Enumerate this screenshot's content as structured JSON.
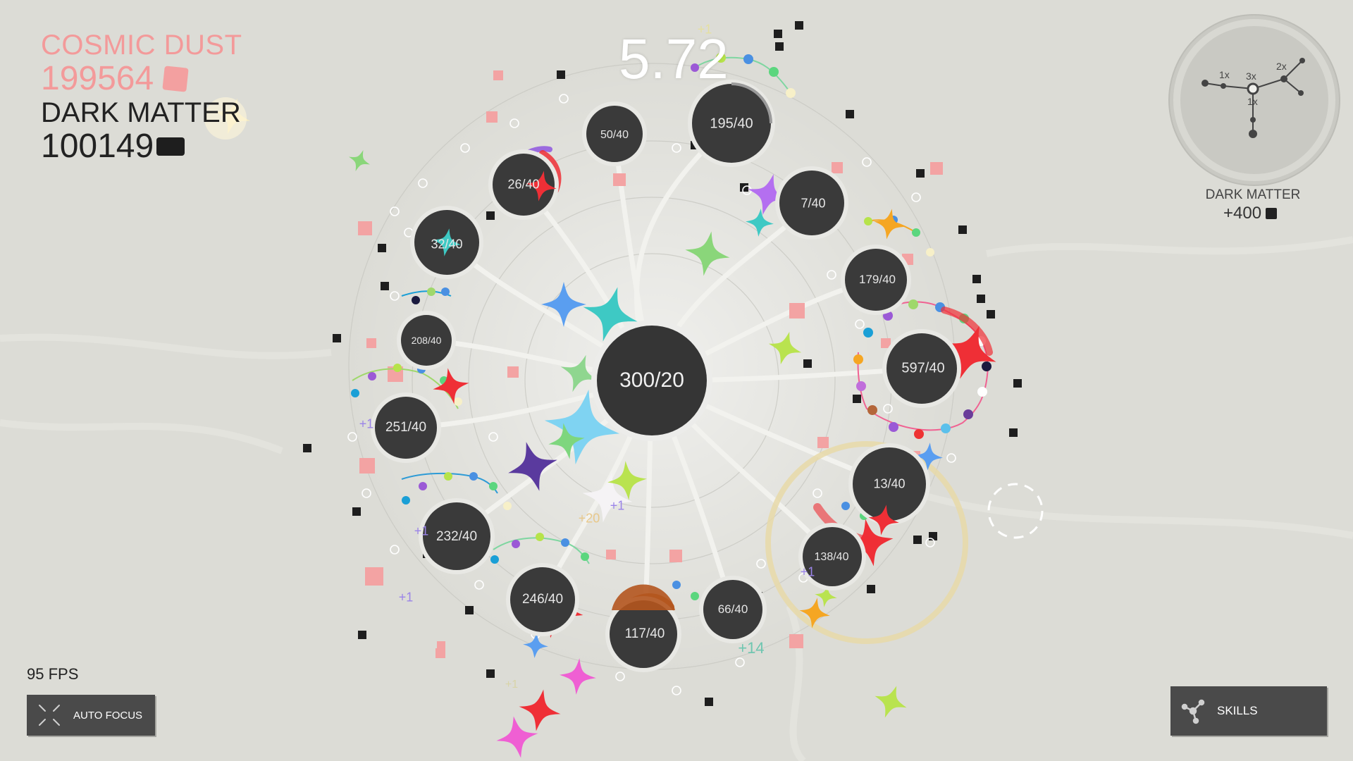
{
  "hud": {
    "cosmic_dust_label": "COSMIC DUST",
    "cosmic_dust_value": "199564",
    "dark_matter_label": "DARK MATTER",
    "dark_matter_value": "100149",
    "timer": "5.72",
    "fps": "95 FPS"
  },
  "minimap": {
    "title": "DARK MATTER",
    "gain": "+400",
    "multipliers": [
      "1x",
      "3x",
      "2x",
      "1x"
    ]
  },
  "buttons": {
    "auto_focus": "AUTO FOCUS",
    "skills": "SKILLS"
  },
  "core": {
    "label": "300/20"
  },
  "nodes": [
    {
      "label": "195/40"
    },
    {
      "label": "50/40"
    },
    {
      "label": "26/40"
    },
    {
      "label": "7/40"
    },
    {
      "label": "32/40"
    },
    {
      "label": "179/40"
    },
    {
      "label": "208/40"
    },
    {
      "label": "597/40"
    },
    {
      "label": "251/40"
    },
    {
      "label": "13/40"
    },
    {
      "label": "232/40"
    },
    {
      "label": "138/40"
    },
    {
      "label": "246/40"
    },
    {
      "label": "66/40"
    },
    {
      "label": "117/40"
    }
  ],
  "floating_text": [
    "+1",
    "+1",
    "+1",
    "+20",
    "+1",
    "+1",
    "+1",
    "+14",
    "+1"
  ],
  "colors": {
    "background": "#dcdcd6",
    "cosmic_dust": "#f39a9a",
    "dark_matter": "#1e1e1e",
    "node_fill": "#353535",
    "button_bg": "#4a4a4a"
  }
}
